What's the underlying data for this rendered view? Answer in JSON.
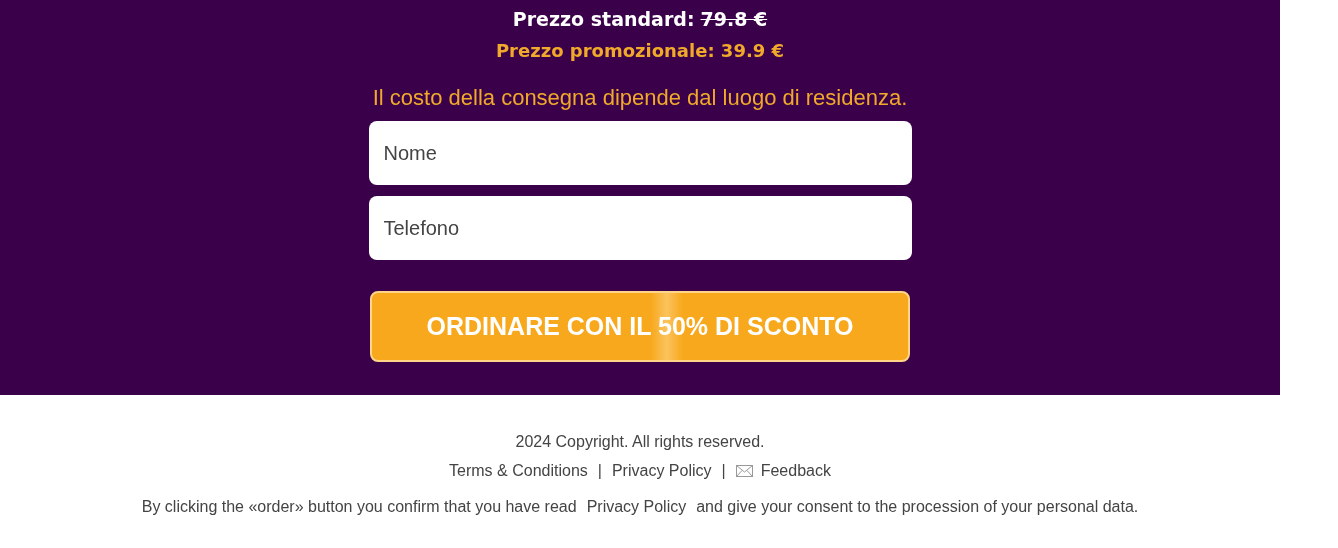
{
  "prices": {
    "standard_label": "Prezzo standard:",
    "standard_value": "79.8 €",
    "promo": "Prezzo promozionale: 39.9 €"
  },
  "delivery_note": "Il costo della consegna dipende dal luogo di residenza.",
  "form": {
    "fields": [
      {
        "placeholder": "Nome"
      },
      {
        "placeholder": "Telefono"
      }
    ],
    "button": "ORDINARE CON IL 50% DI SCONTO"
  },
  "footer": {
    "copyright": "2024 Copyright. All rights reserved.",
    "links": [
      {
        "kind": "link",
        "label": "Terms & Conditions"
      },
      {
        "kind": "separator",
        "label": "|"
      },
      {
        "kind": "link",
        "label": "Privacy Policy"
      },
      {
        "kind": "separator",
        "label": "|"
      },
      {
        "kind": "mail",
        "label": "Feedback"
      }
    ],
    "consent": {
      "before": "By clicking the «order» button you confirm that you have read",
      "link": "Privacy Policy",
      "after": "and give your consent to the procession of your personal data."
    }
  }
}
